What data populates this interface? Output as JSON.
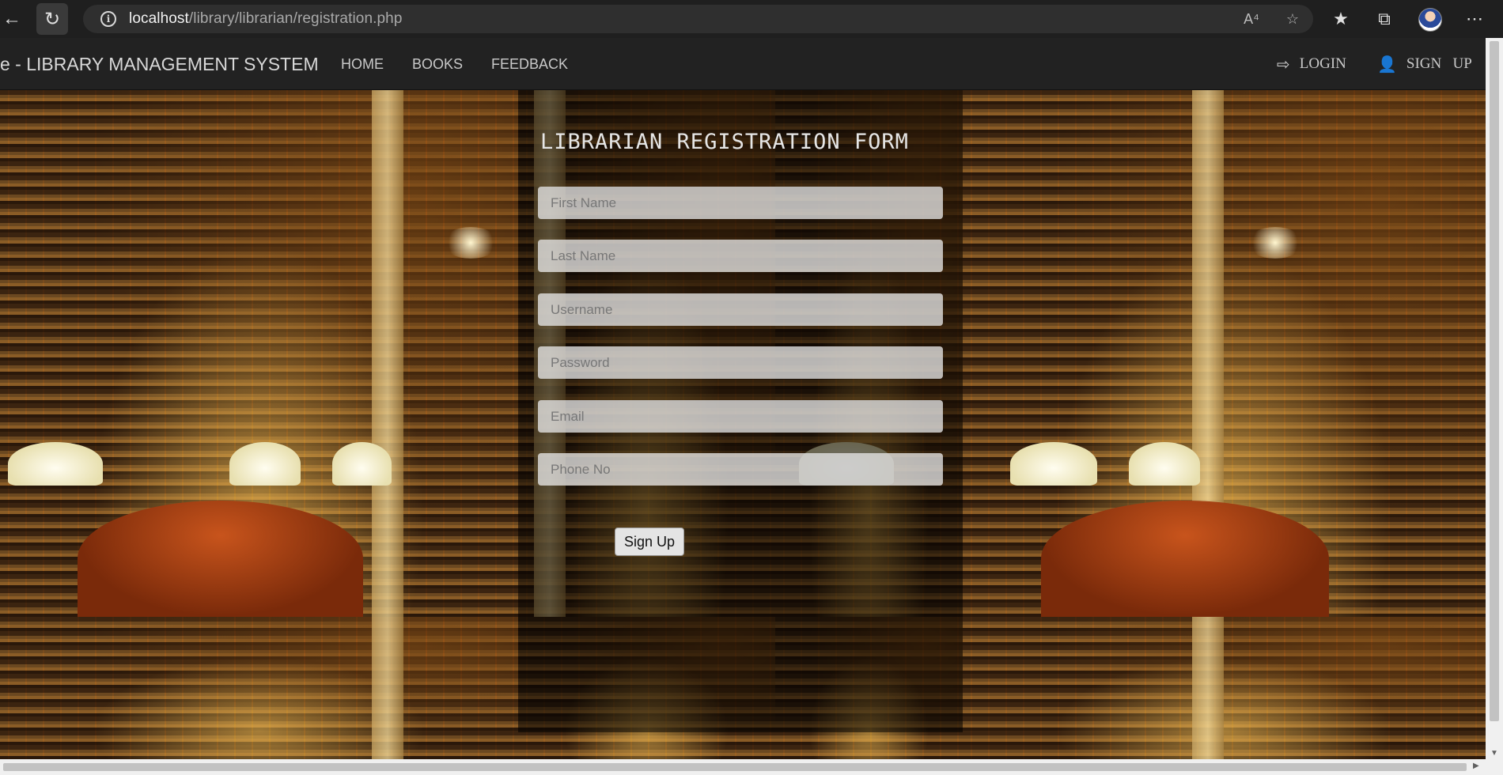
{
  "browser": {
    "back_icon": "arrow-left-icon",
    "reload_icon": "reload-icon",
    "url_host": "localhost",
    "url_path": "/library/librarian/registration.php",
    "icons": [
      "read-aloud-icon",
      "add-favorite-icon",
      "favorites-icon",
      "collections-icon",
      "profile-avatar",
      "more-icon"
    ]
  },
  "nav": {
    "brand": "e - LIBRARY MANAGEMENT SYSTEM",
    "links": [
      {
        "label": "HOME"
      },
      {
        "label": "BOOKS"
      },
      {
        "label": "FEEDBACK"
      }
    ],
    "login_label": "LOGIN",
    "signup_label": "SIGN   UP"
  },
  "form": {
    "title": "LIBRARIAN REGISTRATION FORM",
    "fields": {
      "first_name": {
        "placeholder": "First Name",
        "value": ""
      },
      "last_name": {
        "placeholder": "Last Name",
        "value": ""
      },
      "username": {
        "placeholder": "Username",
        "value": ""
      },
      "password": {
        "placeholder": "Password",
        "value": ""
      },
      "email": {
        "placeholder": "Email",
        "value": ""
      },
      "phone": {
        "placeholder": "Phone No",
        "value": ""
      }
    },
    "submit_label": "Sign Up"
  }
}
